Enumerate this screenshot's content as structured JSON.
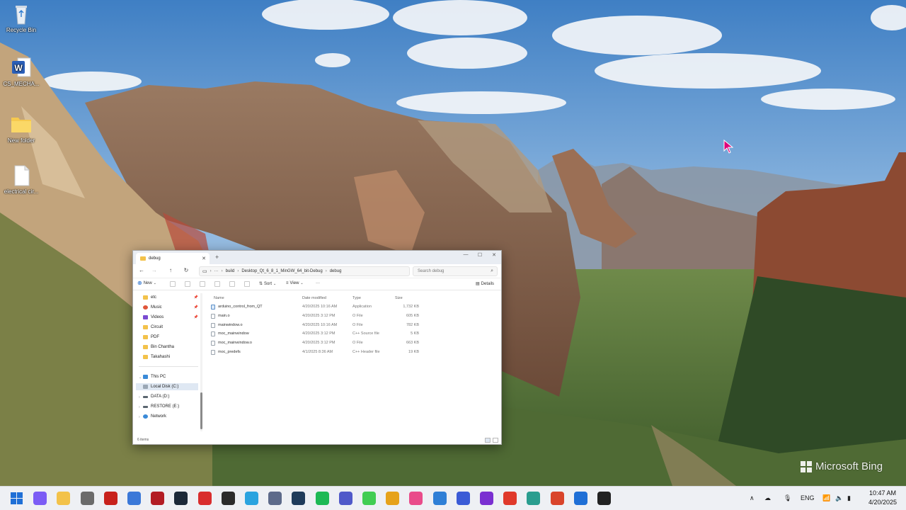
{
  "desktop": {
    "icons": [
      {
        "label": "Recycle Bin",
        "icon": "recycle-bin-icon"
      },
      {
        "label": "CS_MECHA...",
        "icon": "word-document-icon"
      },
      {
        "label": "New folder",
        "icon": "folder-icon"
      },
      {
        "label": "electrical cir...",
        "icon": "blank-file-icon"
      }
    ],
    "watermark": "Microsoft Bing"
  },
  "explorer": {
    "tab_title": "debug",
    "address": {
      "more": "···",
      "segments": [
        "build",
        "Desktop_Qt_6_8_1_MinGW_64_bit-Debug",
        "debug"
      ],
      "search_placeholder": "Search debug"
    },
    "toolbar": {
      "new_label": "New",
      "sort_label": "Sort",
      "view_label": "View",
      "more_label": "···",
      "details_label": "Details"
    },
    "nav": {
      "quick": [
        {
          "label": "etc",
          "color": "#f3c24a",
          "pinned": true
        },
        {
          "label": "Music",
          "color": "#e0563a",
          "pinned": true
        },
        {
          "label": "Videos",
          "color": "#7a4bd1",
          "pinned": true
        },
        {
          "label": "Circuit",
          "color": "#f3c24a",
          "pinned": false
        },
        {
          "label": "PDF",
          "color": "#f3c24a",
          "pinned": false
        },
        {
          "label": "Bin Chantha",
          "color": "#f3c24a",
          "pinned": false
        },
        {
          "label": "Takahashi",
          "color": "#f3c24a",
          "pinned": false
        }
      ],
      "this_pc": "This PC",
      "drives": [
        "Local Disk (C:)",
        "DATA (D:)",
        "RESTORE (E:)"
      ],
      "network": "Network"
    },
    "columns": {
      "name": "Name",
      "date": "Date modified",
      "type": "Type",
      "size": "Size"
    },
    "files": [
      {
        "name": "arduino_control_from_QT",
        "date": "4/20/2025 10:16 AM",
        "type": "Application",
        "size": "1,732 KB",
        "kind": "app"
      },
      {
        "name": "main.o",
        "date": "4/20/2025 3:12 PM",
        "type": "O File",
        "size": "605 KB",
        "kind": "file"
      },
      {
        "name": "mainwindow.o",
        "date": "4/20/2025 10:16 AM",
        "type": "O File",
        "size": "782 KB",
        "kind": "file"
      },
      {
        "name": "moc_mainwindow",
        "date": "4/20/2025 3:12 PM",
        "type": "C++ Source file",
        "size": "5 KB",
        "kind": "file"
      },
      {
        "name": "moc_mainwindow.o",
        "date": "4/20/2025 3:12 PM",
        "type": "O File",
        "size": "663 KB",
        "kind": "file"
      },
      {
        "name": "moc_predefs",
        "date": "4/1/2025 8:36 AM",
        "type": "C++ Header file",
        "size": "19 KB",
        "kind": "file"
      }
    ],
    "status": "6 items"
  },
  "taskbar": {
    "apps": [
      {
        "name": "start",
        "color": "#1f6fd6"
      },
      {
        "name": "copilot",
        "color": "#7b5cf5"
      },
      {
        "name": "file-explorer",
        "color": "#f3c24a"
      },
      {
        "name": "app-4",
        "color": "#6b6b6b"
      },
      {
        "name": "acrobat",
        "color": "#c8221c"
      },
      {
        "name": "3d-viewer",
        "color": "#3b78d8"
      },
      {
        "name": "solidworks",
        "color": "#b31c24"
      },
      {
        "name": "steam",
        "color": "#1b2838"
      },
      {
        "name": "app-9",
        "color": "#d92d2d"
      },
      {
        "name": "obs",
        "color": "#2b2b2b"
      },
      {
        "name": "telegram",
        "color": "#2aa3df"
      },
      {
        "name": "app-12",
        "color": "#5d6a8a"
      },
      {
        "name": "tia-portal",
        "color": "#1f3b5a"
      },
      {
        "name": "spotify",
        "color": "#1db954"
      },
      {
        "name": "teams",
        "color": "#5059c9"
      },
      {
        "name": "qt-creator",
        "color": "#41cd52"
      },
      {
        "name": "app-17",
        "color": "#e6a21a"
      },
      {
        "name": "app-18",
        "color": "#e94b8a"
      },
      {
        "name": "app-19",
        "color": "#2f7fd6"
      },
      {
        "name": "app-20",
        "color": "#3b5bd6"
      },
      {
        "name": "app-21",
        "color": "#7a2fd1"
      },
      {
        "name": "chrome",
        "color": "#e0392b"
      },
      {
        "name": "app-23",
        "color": "#2a9d8f"
      },
      {
        "name": "app-24",
        "color": "#d9442b"
      },
      {
        "name": "defender",
        "color": "#1f6fd6"
      },
      {
        "name": "terminal",
        "color": "#222222"
      }
    ],
    "tray": {
      "chevron": "∧",
      "language": "ENG"
    },
    "time": "10:47 AM",
    "date": "4/20/2025"
  }
}
